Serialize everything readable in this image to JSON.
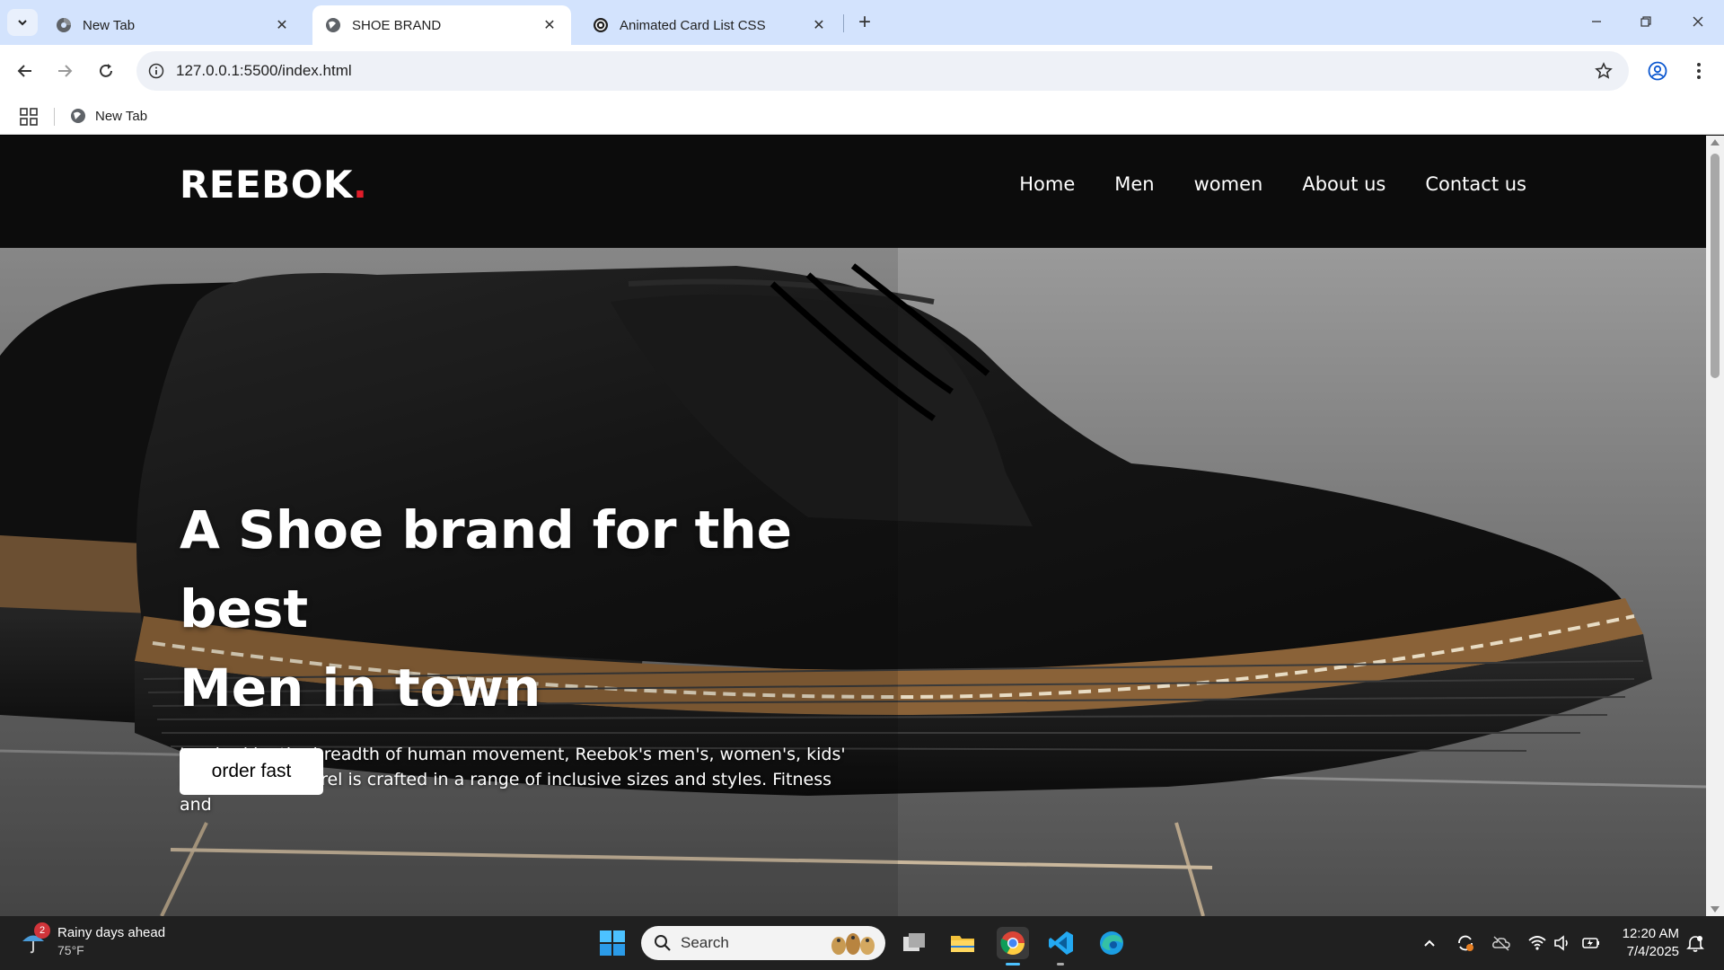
{
  "browser": {
    "tabs": [
      {
        "label": "New Tab",
        "active": false
      },
      {
        "label": "SHOE BRAND",
        "active": true
      },
      {
        "label": "Animated Card List CSS",
        "active": false
      }
    ],
    "url": "127.0.0.1:5500/index.html",
    "bookmarks": [
      {
        "label": "New Tab"
      }
    ]
  },
  "site": {
    "logo": "REEBOK",
    "logo_dot": ".",
    "nav": [
      "Home",
      "Men",
      "women",
      "About us",
      "Contact us"
    ],
    "hero": {
      "title_line1": "A Shoe brand for the best",
      "title_line2": "Men in town",
      "description": "Inspired by the breadth of human movement, Reebok's men's, women's, kids' and unisex apparel is crafted in a range of inclusive sizes and styles. Fitness and",
      "cta": "order fast"
    }
  },
  "taskbar": {
    "weather_title": "Rainy days ahead",
    "weather_temp": "75°F",
    "weather_badge": "2",
    "search_placeholder": "Search",
    "time": "12:20 AM",
    "date": "7/4/2025"
  },
  "colors": {
    "tabstrip": "#d3e3fd",
    "header_bg": "#0c0c0c",
    "logo_dot": "#e11d2a",
    "taskbar": "#202020"
  }
}
